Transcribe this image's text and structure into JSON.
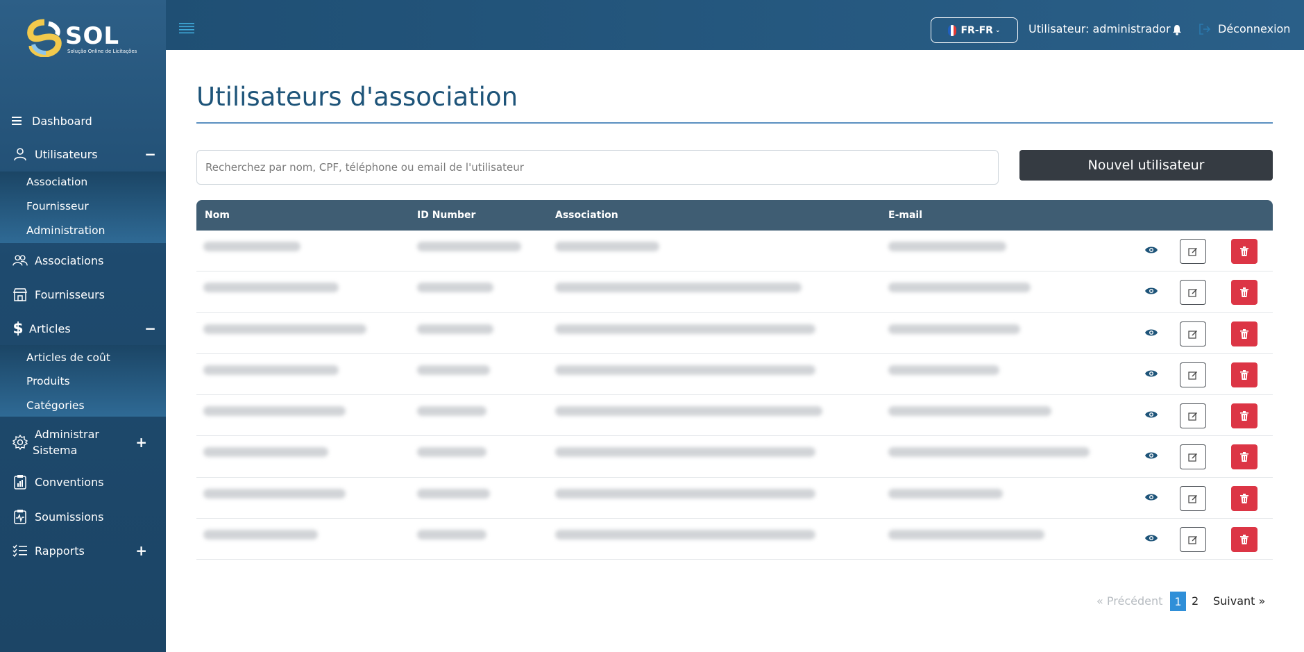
{
  "app": {
    "logo_text": "SOL",
    "logo_sub": "Solução Online de Licitações"
  },
  "sidebar": {
    "items": [
      {
        "label": "Dashboard",
        "icon": "list-icon"
      },
      {
        "label": "Utilisateurs",
        "icon": "user-icon",
        "toggle": "−"
      },
      {
        "label": "Associations",
        "icon": "users-icon"
      },
      {
        "label": "Fournisseurs",
        "icon": "store-icon"
      },
      {
        "label": "Articles",
        "icon": "dollar-icon",
        "toggle": "−"
      },
      {
        "label": "Administrar",
        "label2": "Sistema",
        "icon": "gear-icon",
        "toggle": "+"
      },
      {
        "label": "Conventions",
        "icon": "clipboard-chart-icon"
      },
      {
        "label": "Soumissions",
        "icon": "clipboard-pulse-icon"
      },
      {
        "label": "Rapports",
        "icon": "checklist-icon",
        "toggle": "+"
      }
    ],
    "utilisateurs_sub": [
      "Association",
      "Fournisseur",
      "Administration"
    ],
    "articles_sub": [
      "Articles de coût",
      "Produits",
      "Catégories"
    ]
  },
  "header": {
    "language": "FR-FR",
    "user_label": "Utilisateur: administrador",
    "logout": "Déconnexion"
  },
  "main": {
    "title": "Utilisateurs d'association",
    "search_placeholder": "Recherchez par nom, CPF, téléphone ou email de l'utilisateur",
    "new_user_button": "Nouvel utilisateur",
    "columns": [
      "Nom",
      "ID Number",
      "Association",
      "E-mail"
    ],
    "rows_count_note": "8 rows, contents blurred"
  },
  "pagination": {
    "prev": "«  Précédent",
    "pages": [
      "1",
      "2"
    ],
    "current": "1",
    "next": "Suivant  »"
  },
  "colors": {
    "sidebar": "#1e4a6e",
    "header": "#245781",
    "title": "#1e5479",
    "table_header": "#3f5d73",
    "primary_dark": "#353b42",
    "danger": "#dc3545",
    "page_active": "#2f8fd8"
  }
}
